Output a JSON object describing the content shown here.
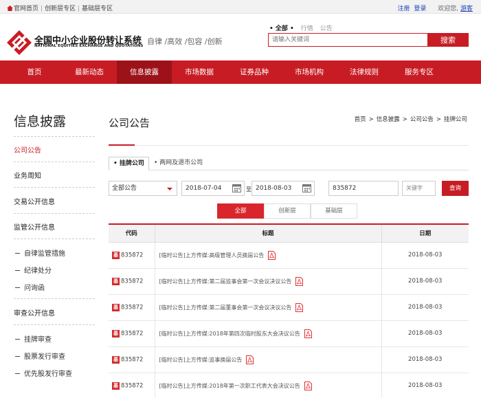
{
  "topbar": {
    "links": [
      "官网首页",
      "创新层专区",
      "基础层专区"
    ],
    "register": "注册",
    "login": "登录",
    "welcome": "欢迎您,",
    "guest": "游客"
  },
  "header": {
    "logo_cn": "全国中小企业股份转让系统",
    "logo_en": "NATIONAL EQUITIES EXCHANGE AND QUOTATIONS",
    "slogan": "自律 /高效 /包容 /创新",
    "search_tabs": [
      "• 全部 •",
      "行情",
      "公告"
    ],
    "search_placeholder": "请输入关键词",
    "search_button": "搜索"
  },
  "nav": [
    "首页",
    "最新动态",
    "信息披露",
    "市场数据",
    "证券品种",
    "市场机构",
    "法律规则",
    "服务专区"
  ],
  "sidebar": {
    "title": "信息披露",
    "items": [
      "公司公告",
      "业务周知",
      "交易公开信息",
      "监管公开信息"
    ],
    "sub1": [
      "自律监管措施",
      "纪律处分",
      "问询函"
    ],
    "item5": "审查公开信息",
    "sub2": [
      "挂牌审查",
      "股票发行审查",
      "优先股发行审查"
    ]
  },
  "main": {
    "title": "公司公告",
    "breadcrumb": [
      "首页",
      "信息披露",
      "公司公告",
      "挂牌公司"
    ],
    "tabs": [
      "• 挂牌公司",
      "• 两网及退市公司"
    ],
    "filters": {
      "type": "全部公告",
      "date_from": "2018-07-04",
      "to": "至",
      "date_to": "2018-08-03",
      "code": "835872",
      "keyword_placeholder": "关键字",
      "query": "查询"
    },
    "segments": [
      "全部",
      "创新层",
      "基础层"
    ]
  },
  "table": {
    "headers": [
      "代码",
      "标题",
      "日期"
    ],
    "badge": "基",
    "rows": [
      {
        "code": "835872",
        "title": "[临时公告]上方传媒:高级管理人员换届公告",
        "date": "2018-08-03"
      },
      {
        "code": "835872",
        "title": "[临时公告]上方传媒:第二届监事会第一次会议决议公告",
        "date": "2018-08-03"
      },
      {
        "code": "835872",
        "title": "[临时公告]上方传媒:第二届董事会第一次会议决议公告",
        "date": "2018-08-03"
      },
      {
        "code": "835872",
        "title": "[临时公告]上方传媒:2018年第四次临时股东大会决议公告",
        "date": "2018-08-03"
      },
      {
        "code": "835872",
        "title": "[临时公告]上方传媒:监事换届公告",
        "date": "2018-08-03"
      },
      {
        "code": "835872",
        "title": "[临时公告]上方传媒:2018年第一次职工代表大会决议公告",
        "date": "2018-08-03"
      }
    ]
  },
  "colors": {
    "brand_red": "#c81c24",
    "nav_active": "#9d1218",
    "link_blue": "#1a3fb3"
  },
  "icons": [
    "home-icon",
    "calendar-icon",
    "pdf-icon",
    "dropdown-caret-icon"
  ]
}
